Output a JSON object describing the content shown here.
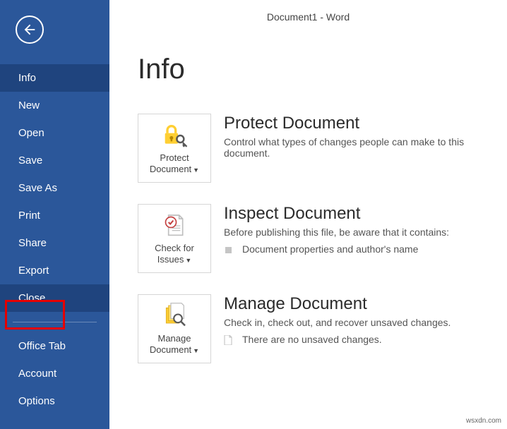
{
  "window_title": "Document1 - Word",
  "page_title": "Info",
  "sidebar": {
    "items": [
      {
        "label": "Info",
        "active": true,
        "highlighted": false
      },
      {
        "label": "New",
        "active": false,
        "highlighted": false
      },
      {
        "label": "Open",
        "active": false,
        "highlighted": false
      },
      {
        "label": "Save",
        "active": false,
        "highlighted": false
      },
      {
        "label": "Save As",
        "active": false,
        "highlighted": false
      },
      {
        "label": "Print",
        "active": false,
        "highlighted": false
      },
      {
        "label": "Share",
        "active": false,
        "highlighted": false
      },
      {
        "label": "Export",
        "active": false,
        "highlighted": false
      },
      {
        "label": "Close",
        "active": true,
        "highlighted": true
      }
    ],
    "footer_items": [
      {
        "label": "Office Tab"
      },
      {
        "label": "Account"
      },
      {
        "label": "Options"
      }
    ]
  },
  "sections": {
    "protect": {
      "tile_label": "Protect Document",
      "title": "Protect Document",
      "desc": "Control what types of changes people can make to this document."
    },
    "inspect": {
      "tile_label": "Check for Issues",
      "title": "Inspect Document",
      "desc": "Before publishing this file, be aware that it contains:",
      "bullet": "Document properties and author's name"
    },
    "manage": {
      "tile_label": "Manage Document",
      "title": "Manage Document",
      "desc": "Check in, check out, and recover unsaved changes.",
      "bullet": "There are no unsaved changes."
    }
  },
  "watermark": "wsxdn.com"
}
